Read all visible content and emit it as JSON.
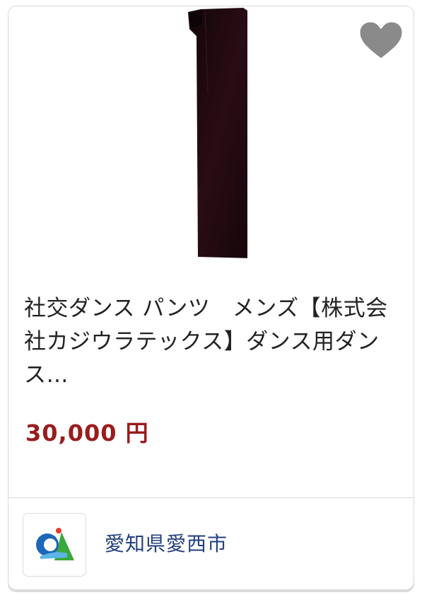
{
  "product": {
    "image_icon": "dance-pants-image",
    "title": "社交ダンス パンツ　メンズ【株式会社カジウラテックス】ダンス用ダンス…",
    "price": "30,000 円"
  },
  "favorite": {
    "icon": "heart-icon",
    "color": "#8a8a8a"
  },
  "shop": {
    "logo_icon": "municipality-logo-icon",
    "name": "愛知県愛西市"
  },
  "colors": {
    "price": "#9a1c1c",
    "shop_link": "#233f7e",
    "pants": "#1c0b10"
  }
}
